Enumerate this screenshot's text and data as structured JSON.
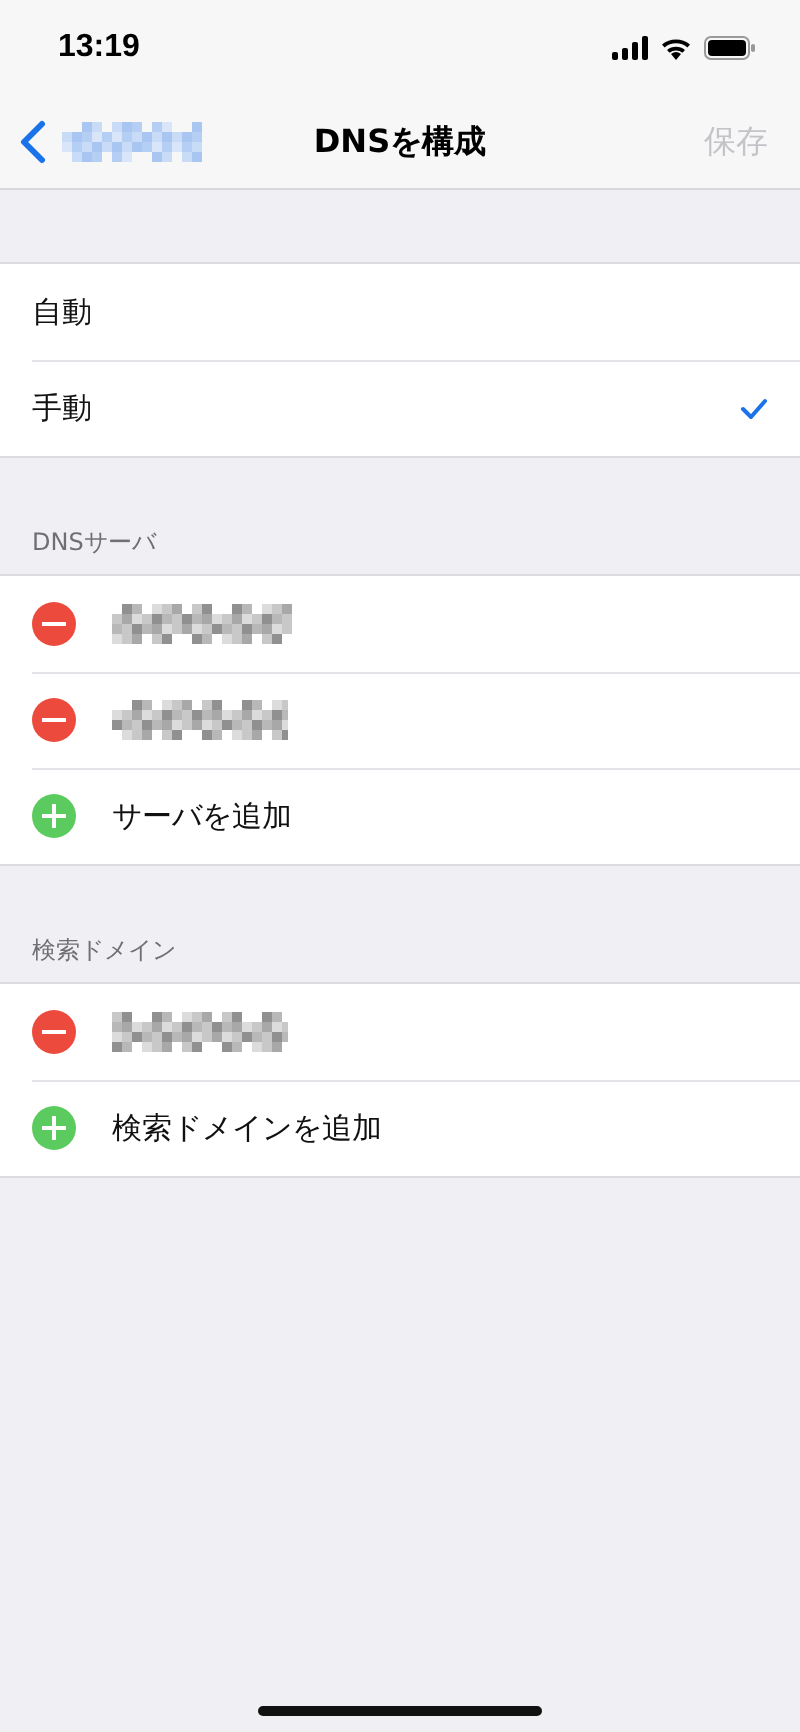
{
  "status_bar": {
    "time": "13:19"
  },
  "nav": {
    "back": {
      "kind": "redacted"
    },
    "title": "DNSを構成",
    "save": {
      "label": "保存",
      "disabled": true
    }
  },
  "modes": [
    {
      "label": "自動",
      "selected": false
    },
    {
      "label": "手動",
      "selected": true
    }
  ],
  "sections": [
    {
      "header": "DNSサーバ",
      "rows": [
        {
          "kind": "remove"
        },
        {
          "kind": "remove"
        },
        {
          "kind": "add",
          "label": "サーバを追加"
        }
      ]
    },
    {
      "header": "検索ドメイン",
      "rows": [
        {
          "kind": "remove"
        },
        {
          "kind": "add",
          "label": "検索ドメインを追加"
        }
      ]
    }
  ]
}
